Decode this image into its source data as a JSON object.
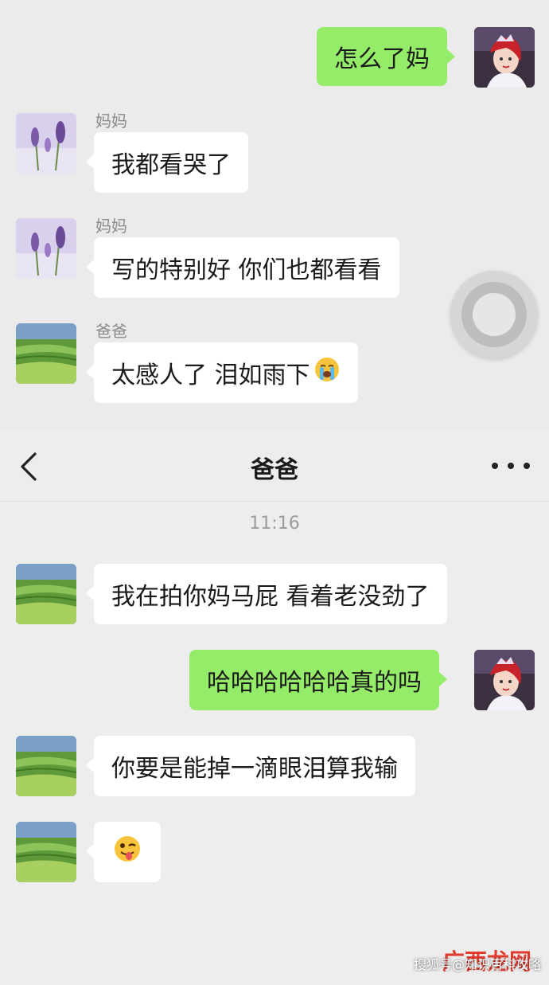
{
  "top_chat": {
    "messages": [
      {
        "side": "out",
        "text": "怎么了妈",
        "avatar": "princess-avatar"
      },
      {
        "side": "in",
        "sender": "妈妈",
        "text": "我都看哭了",
        "avatar": "lavender-avatar"
      },
      {
        "side": "in",
        "sender": "妈妈",
        "text": "写的特别好 你们也都看看",
        "avatar": "lavender-avatar"
      },
      {
        "side": "in",
        "sender": "爸爸",
        "text": "太感人了 泪如雨下",
        "emoji": "loudly-crying-face",
        "avatar": "field-avatar"
      }
    ]
  },
  "navbar": {
    "title": "爸爸",
    "back_icon": "chevron-left-icon",
    "more_icon": "more-dots-icon"
  },
  "bottom_chat": {
    "timestamp": "11:16",
    "messages": [
      {
        "side": "in",
        "text": "我在拍你妈马屁 看着老没劲了",
        "avatar": "field-avatar"
      },
      {
        "side": "out",
        "text": "哈哈哈哈哈哈真的吗",
        "avatar": "princess-avatar"
      },
      {
        "side": "in",
        "text": "你要是能掉一滴眼泪算我输",
        "avatar": "field-avatar"
      },
      {
        "side": "in",
        "emoji": "winking-tongue-face",
        "avatar": "field-avatar"
      }
    ]
  },
  "watermark": {
    "text": "搜狐号@知识百科攻略",
    "logo": "广西龙网"
  },
  "colors": {
    "outgoing_bubble": "#95ec69",
    "incoming_bubble": "#ffffff",
    "background": "#ededed"
  }
}
